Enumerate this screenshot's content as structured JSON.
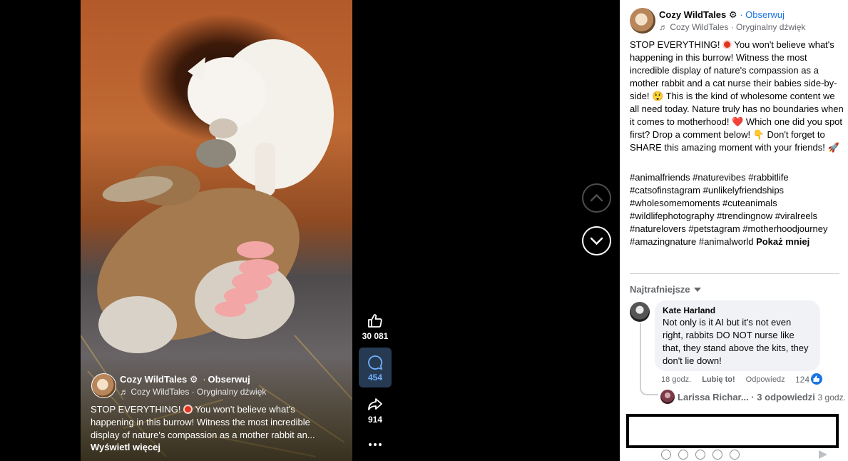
{
  "colors": {
    "accent": "#1b74e4",
    "background": "#000000",
    "panel": "#ffffff",
    "recording_red": "#e0331e"
  },
  "video": {
    "overlay": {
      "page_name": "Cozy WildTales",
      "verified_icon": "gear-icon",
      "dot": "·",
      "follow_label": "Obserwuj",
      "audio_line": "♬ Cozy WildTales · Oryginalny dźwięk",
      "caption_part1": "STOP EVERYTHING!",
      "caption_part2": " You won't believe what's happening in this burrow! Witness the most incredible display of nature's compassion as a mother rabbit an...",
      "see_more": "Wyświetl więcej"
    }
  },
  "actions": {
    "like_count": "30 081",
    "comment_count": "454",
    "share_count": "914",
    "more_icon": "ellipsis-icon"
  },
  "panel": {
    "page_name": "Cozy WildTales",
    "gear": "⚙",
    "follow_label": "· Obserwuj",
    "audio_line": "♬ Cozy WildTales · Oryginalny dźwięk",
    "desc_1": "STOP EVERYTHING! ",
    "desc_2": " You won't believe what's happening in this burrow! Witness the most incredible display of nature's compassion as a mother rabbit and a cat nurse their babies side-by-side! ",
    "emoji_astonished": "😲",
    "desc_3": " This is the kind of wholesome content we all need today. Nature truly has no boundaries when it comes to motherhood! ",
    "emoji_heart": "❤️",
    "desc_4": " Which one did you spot first? Drop a comment below! ",
    "emoji_point": "👇",
    "desc_5": " Don't forget to SHARE this amazing moment with your friends! ",
    "emoji_rocket": "🚀",
    "hashtags": "#animalfriends #naturevibes #rabbitlife #catsofinstagram #unlikelyfriendships #wholesomemoments #cuteanimals #wildlifephotography #trendingnow #viralreels #naturelovers #petstagram #motherhoodjourney #amazingnature #animalworld",
    "show_less": "Pokaż mniej",
    "sort_label": "Najtrafniejsze",
    "comment": {
      "author": "Kate Harland",
      "text": "Not only is it AI but it's not even right, rabbits DO NOT nurse like that, they stand above the kits, they don't lie down!",
      "time": "18 godz.",
      "like_label": "Lubię to!",
      "reply_label": "Odpowiedz",
      "likes": "124"
    },
    "reply_preview": {
      "author": "Larissa Richar...",
      "replies": "· 3 odpowiedzi",
      "time": "3 godz."
    }
  }
}
